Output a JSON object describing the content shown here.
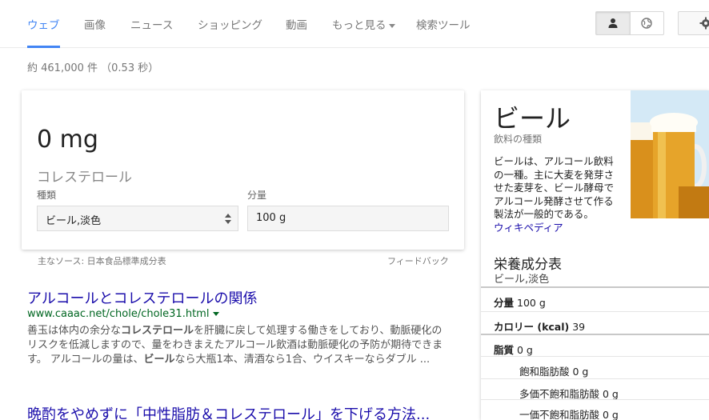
{
  "nav": {
    "tabs": [
      {
        "label": "ウェブ",
        "active": true
      },
      {
        "label": "画像"
      },
      {
        "label": "ニュース"
      },
      {
        "label": "ショッピング"
      },
      {
        "label": "動画"
      },
      {
        "label": "もっと見る"
      },
      {
        "label": "検索ツール"
      }
    ],
    "icons": [
      "person-icon",
      "globe-icon",
      "gear-icon"
    ]
  },
  "stats": "約 461,000 件 （0.53 秒）",
  "calculator": {
    "value": "0 mg",
    "nutrient": "コレステロール",
    "type_label": "種類",
    "type_value": "ビール,淡色",
    "amount_label": "分量",
    "amount_value": "100 g",
    "source": "主なソース: 日本食品標準成分表",
    "feedback": "フィードバック"
  },
  "results": [
    {
      "title": "アルコールとコレステロールの関係",
      "url": "www.caaac.net/chole/chole31.html",
      "snippet_parts": [
        {
          "t": "善玉は体内の余分な",
          "b": false
        },
        {
          "t": "コレステロール",
          "b": true
        },
        {
          "t": "を肝臓に戻して処理する働きをしており、動脈硬化のリスクを低減しますので、量をわきまえたアルコール飲酒は動脈硬化の予防が期待できます。 アルコールの量は、",
          "b": false
        },
        {
          "t": "ビール",
          "b": true
        },
        {
          "t": "なら大瓶1本、清酒なら1合、ウイスキーならダブル ...",
          "b": false
        }
      ]
    },
    {
      "title": "晩酌をやめずに「中性脂肪＆コレステロール」を下げる方法..."
    }
  ],
  "knowledge_panel": {
    "title": "ビール",
    "subtitle": "飲料の種類",
    "description": "ビールは、アルコール飲料の一種。主に大麦を発芽させた麦芽を、ビール酵母でアルコール発酵させて作る製法が一般的である。",
    "wiki_link": "ウィキペディア",
    "nutrition_title": "栄養成分表",
    "nutrition_sub": "ビール,淡色",
    "rows": [
      {
        "label": "分量",
        "value": "100 g"
      },
      {
        "label": "カロリー (kcal)",
        "value": "39"
      },
      {
        "label": "脂質",
        "value": "0 g"
      },
      {
        "label": "飽和脂肪酸",
        "value": "0 g"
      },
      {
        "label": "多価不飽和脂肪酸",
        "value": "0 g"
      },
      {
        "label": "一価不飽和脂肪酸",
        "value": "0 g"
      }
    ]
  }
}
